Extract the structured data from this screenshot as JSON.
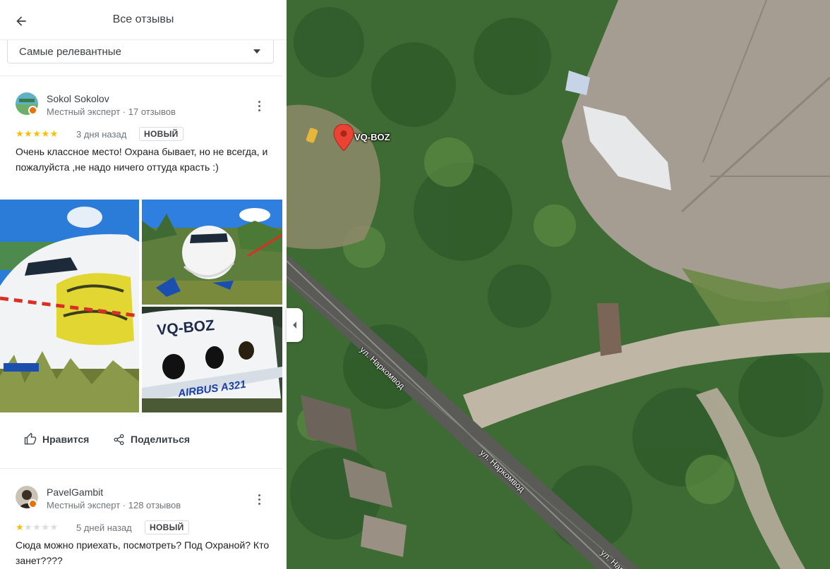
{
  "header": {
    "title": "Все отзывы"
  },
  "sort": {
    "selected": "Самые релевантные"
  },
  "reviews": [
    {
      "name": "Sokol Sokolov",
      "meta": "Местный эксперт · 17 отзывов",
      "rating": 5,
      "stars_on": "★★★★★",
      "stars_off": "",
      "date": "3 дня назад",
      "badge": "НОВЫЙ",
      "text": "Очень классное место! Охрана бывает, но не всегда, и пожалуйста ,не надо ничего оттуда красть :)",
      "photos": {
        "registration": "VQ-BOZ",
        "airline_text": "AIRBUS A321"
      },
      "actions": {
        "like": "Нравится",
        "share": "Поделиться"
      }
    },
    {
      "name": "PavelGambit",
      "meta": "Местный эксперт · 128 отзывов",
      "rating": 1,
      "stars_on": "★",
      "stars_off": "★★★★",
      "date": "5 дней назад",
      "badge": "НОВЫЙ",
      "text": "Сюда можно приехать, посмотреть? Под Охраной? Кто занет????"
    }
  ],
  "map": {
    "marker_label": "VQ-BOZ",
    "street_label": "ул. Наркомвод",
    "colors": {
      "marker": "#ea4335",
      "forest": "#3f6a33",
      "concrete": "#a89f94"
    }
  },
  "icons": {
    "back": "arrow-left-icon",
    "more": "more-vert-icon",
    "like": "thumb-up-icon",
    "share": "share-icon",
    "dropdown": "caret-down-icon",
    "collapse": "chevron-left-icon",
    "marker": "map-pin-icon"
  }
}
